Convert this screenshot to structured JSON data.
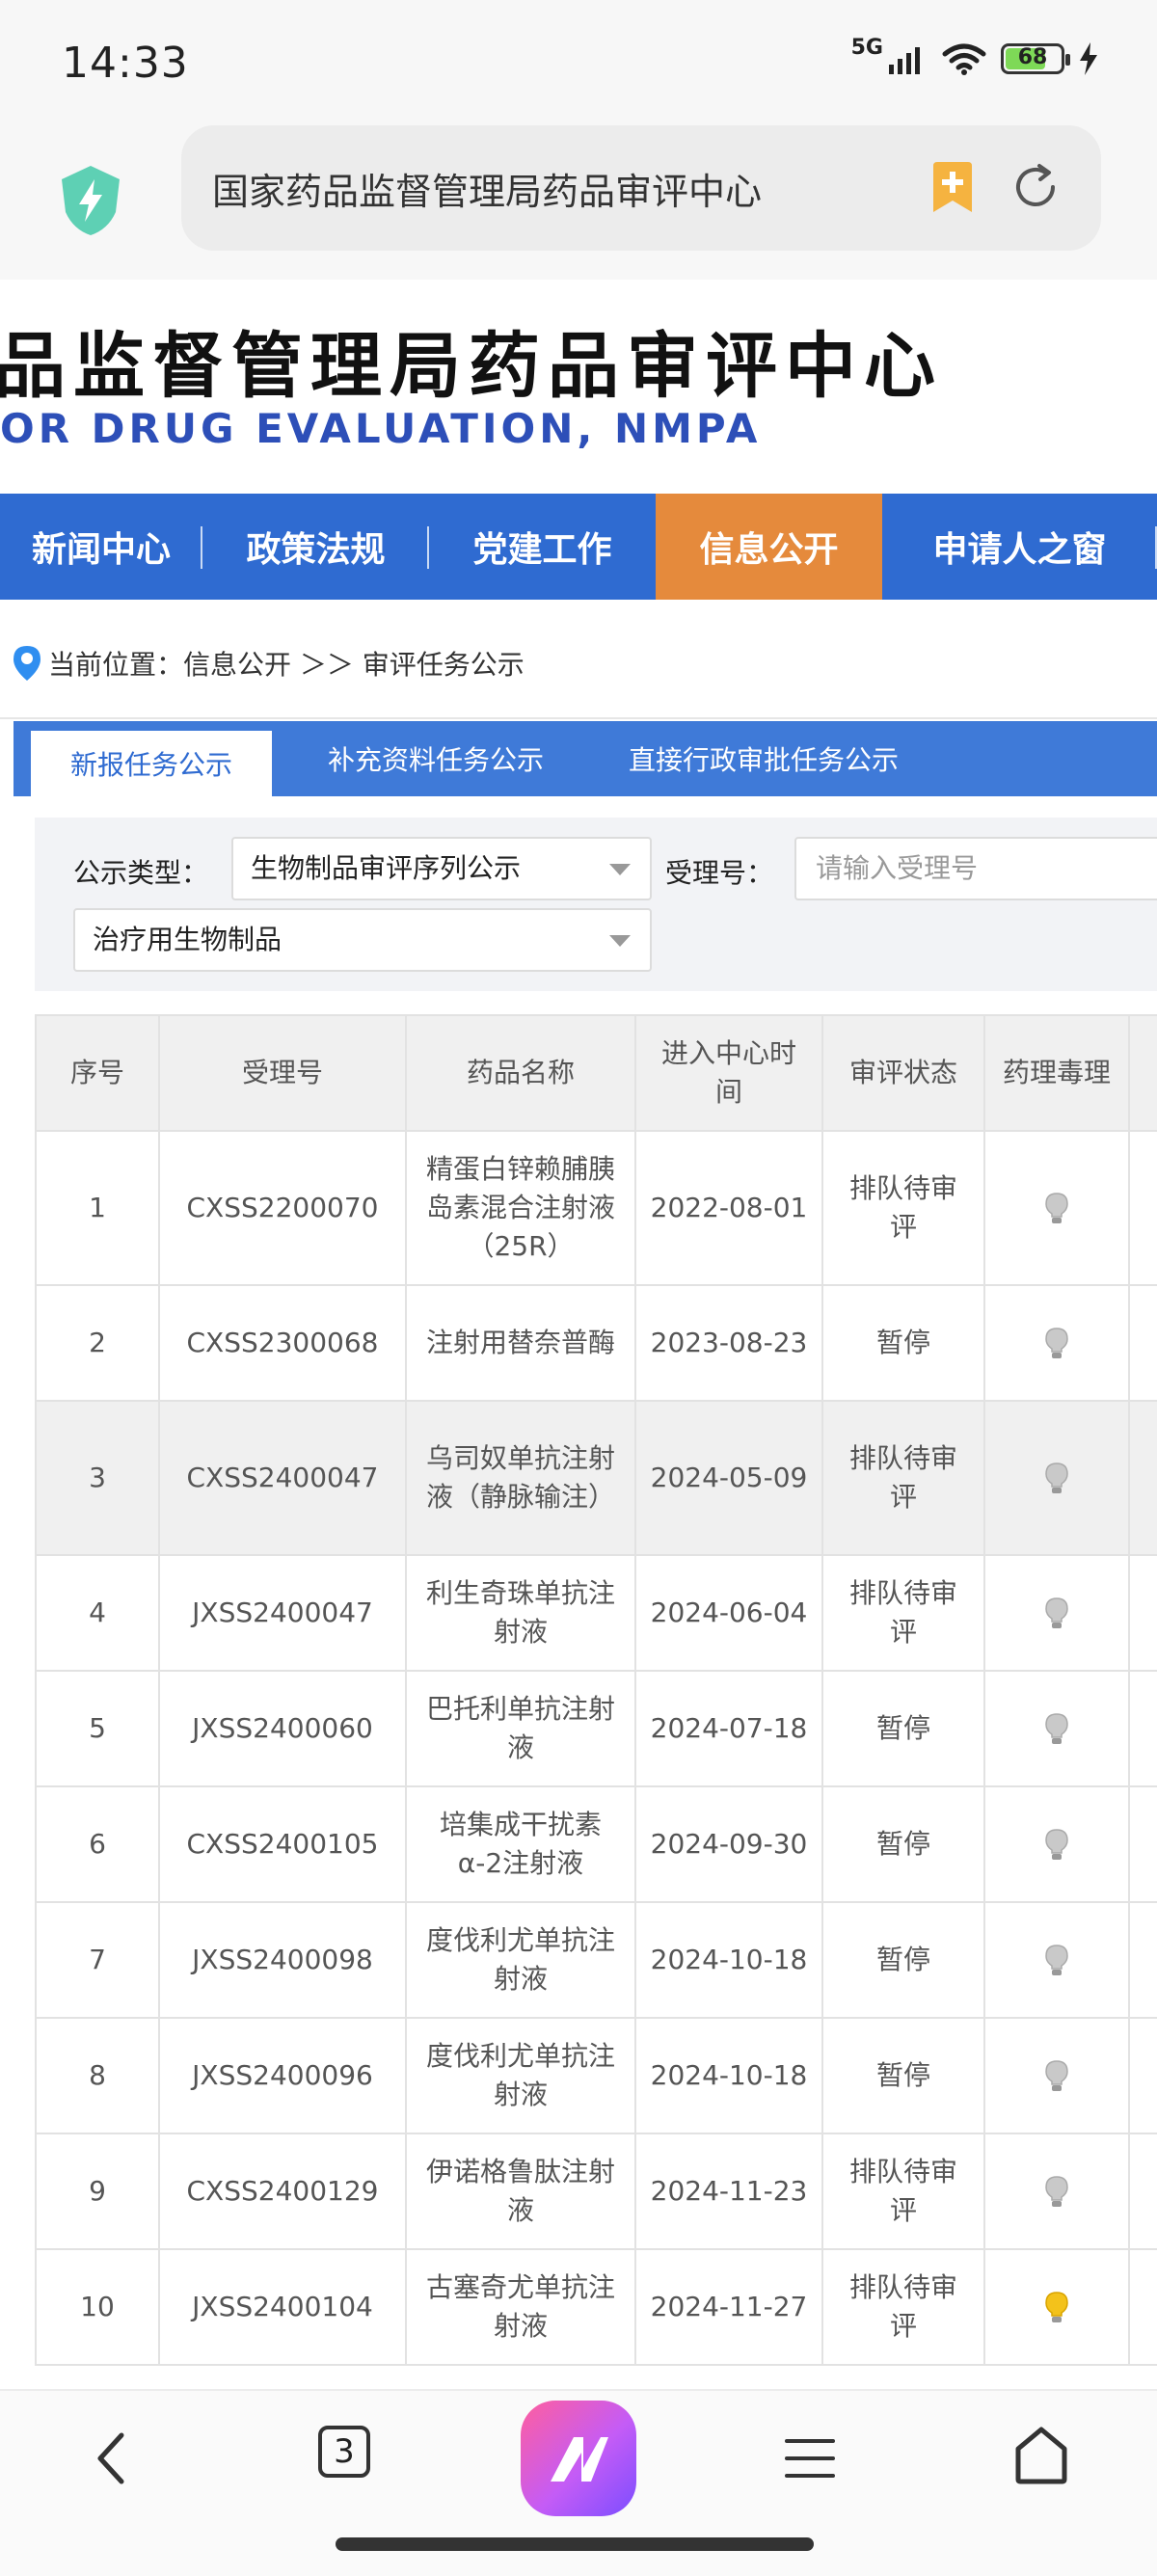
{
  "status_bar": {
    "time": "14:33",
    "network": "5G",
    "battery_level": "68"
  },
  "browser": {
    "url_text": "国家药品监督管理局药品审评中心",
    "icons": [
      "shield-icon",
      "bookmark-add-icon",
      "refresh-icon"
    ],
    "bottom_bar": {
      "tab_count": "3",
      "icons": [
        "back-icon",
        "tabs-icon",
        "app-logo-icon",
        "menu-icon",
        "home-icon"
      ]
    }
  },
  "site": {
    "title": "品监督管理局药品审评中心",
    "subtitle": "OR DRUG EVALUATION, NMPA",
    "nav": [
      "新闻中心",
      "政策法规",
      "党建工作",
      "信息公开",
      "申请人之窗"
    ],
    "nav_active": "信息公开"
  },
  "breadcrumb": {
    "label": "当前位置：信息公开 ＞＞ 审评任务公示"
  },
  "tabs": [
    "新报任务公示",
    "补充资料任务公示",
    "直接行政审批任务公示"
  ],
  "filters": {
    "type_label": "公示类型：",
    "type_value": "生物制品审评序列公示",
    "category_value": "治疗用生物制品",
    "accept_label": "受理号：",
    "accept_placeholder": "请输入受理号"
  },
  "table": {
    "headers": [
      "序号",
      "受理号",
      "药品名称",
      "进入中心时间",
      "审评状态",
      "药理毒理"
    ],
    "rows": [
      {
        "no": "1",
        "id": "CXSS2200070",
        "name": "精蛋白锌赖脯胰岛素混合注射液（25R）",
        "date": "2022-08-01",
        "status": "排队待审评",
        "bulb": "gray"
      },
      {
        "no": "2",
        "id": "CXSS2300068",
        "name": "注射用替奈普酶",
        "date": "2023-08-23",
        "status": "暂停",
        "bulb": "gray"
      },
      {
        "no": "3",
        "id": "CXSS2400047",
        "name": "乌司奴单抗注射液（静脉输注）",
        "date": "2024-05-09",
        "status": "排队待审评",
        "bulb": "gray"
      },
      {
        "no": "4",
        "id": "JXSS2400047",
        "name": "利生奇珠单抗注射液",
        "date": "2024-06-04",
        "status": "排队待审评",
        "bulb": "gray"
      },
      {
        "no": "5",
        "id": "JXSS2400060",
        "name": "巴托利单抗注射液",
        "date": "2024-07-18",
        "status": "暂停",
        "bulb": "gray"
      },
      {
        "no": "6",
        "id": "CXSS2400105",
        "name": "培集成干扰素α-2注射液",
        "date": "2024-09-30",
        "status": "暂停",
        "bulb": "gray"
      },
      {
        "no": "7",
        "id": "JXSS2400098",
        "name": "度伐利尤单抗注射液",
        "date": "2024-10-18",
        "status": "暂停",
        "bulb": "gray"
      },
      {
        "no": "8",
        "id": "JXSS2400096",
        "name": "度伐利尤单抗注射液",
        "date": "2024-10-18",
        "status": "暂停",
        "bulb": "gray"
      },
      {
        "no": "9",
        "id": "CXSS2400129",
        "name": "伊诺格鲁肽注射液",
        "date": "2024-11-23",
        "status": "排队待审评",
        "bulb": "gray"
      },
      {
        "no": "10",
        "id": "JXSS2400104",
        "name": "古塞奇尤单抗注射液",
        "date": "2024-11-27",
        "status": "排队待审评",
        "bulb": "yellow"
      }
    ]
  },
  "colors": {
    "nav_blue": "#2f6bd1",
    "nav_active_orange": "#e58a3c",
    "tab_blue": "#3f7ad8",
    "subtitle_blue": "#2d4fb8",
    "bulb_yellow": "#f3c21b",
    "bulb_gray": "#c9c9c9"
  }
}
